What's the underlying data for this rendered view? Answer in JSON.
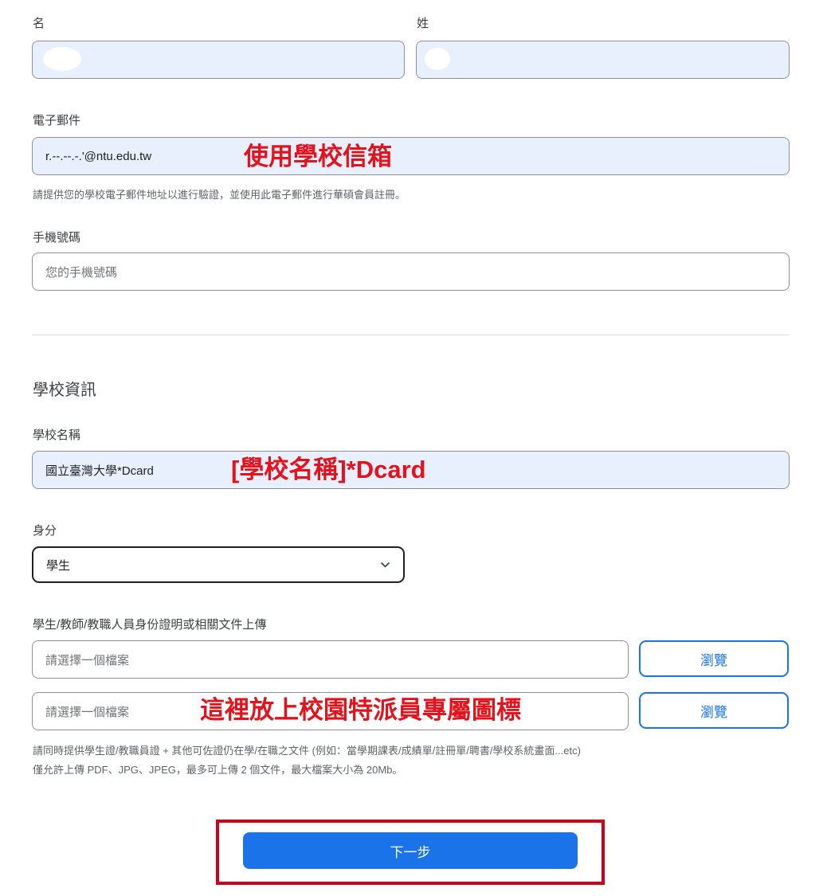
{
  "first_name": {
    "label": "名",
    "value": ""
  },
  "last_name": {
    "label": "姓",
    "value": ""
  },
  "email": {
    "label": "電子郵件",
    "value": "r.--.--.-.'@ntu.edu.tw",
    "annotation": "使用學校信箱",
    "help": "請提供您的學校電子郵件地址以進行驗證，並使用此電子郵件進行華碩會員註冊。"
  },
  "phone": {
    "label": "手機號碼",
    "placeholder": "您的手機號碼"
  },
  "school_section": {
    "title": "學校資訊",
    "school_name_label": "學校名稱",
    "school_name_value": "國立臺灣大學*Dcard",
    "school_name_annotation": "[學校名稱]*Dcard"
  },
  "identity": {
    "label": "身分",
    "selected": "學生"
  },
  "upload": {
    "label": "學生/教師/教職人員身份證明或相關文件上傳",
    "file1_placeholder": "請選擇一個檔案",
    "file2_placeholder": "請選擇一個檔案",
    "browse1": "瀏覽",
    "browse2": "瀏覽",
    "annotation": "這裡放上校園特派員專屬圖標",
    "help_line1": "請同時提供學生證/教職員證 + 其他可佐證仍在學/在職之文件 (例如：當學期課表/成績單/註冊單/聘書/學校系統畫面...etc)",
    "help_line2": "僅允許上傳 PDF、JPG、JPEG，最多可上傳 2 個文件，最大檔案大小為 20Mb。"
  },
  "next_button": {
    "label": "下一步"
  },
  "colors": {
    "accent": "#1a73e8",
    "autofill_bg": "#e8f0fe",
    "annotation_red": "#e4121b",
    "highlight_box": "#d0021b"
  },
  "icons": {
    "select_arrow": "chevron-down-icon"
  }
}
